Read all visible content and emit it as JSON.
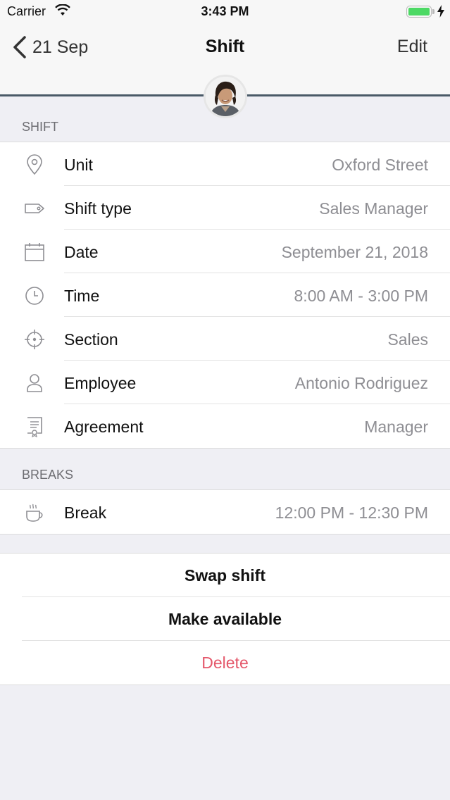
{
  "status_bar": {
    "carrier": "Carrier",
    "time": "3:43 PM",
    "battery_color": "#4cd964"
  },
  "nav": {
    "back_label": "21 Sep",
    "title": "Shift",
    "edit_label": "Edit",
    "accent_line_color": "#4a5a67"
  },
  "shift_section": {
    "header": "SHIFT",
    "rows": [
      {
        "icon": "location-pin-icon",
        "label": "Unit",
        "value": "Oxford Street"
      },
      {
        "icon": "tag-icon",
        "label": "Shift type",
        "value": "Sales Manager"
      },
      {
        "icon": "calendar-icon",
        "label": "Date",
        "value": "September 21, 2018"
      },
      {
        "icon": "clock-icon",
        "label": "Time",
        "value": "8:00 AM - 3:00 PM"
      },
      {
        "icon": "crosshair-icon",
        "label": "Section",
        "value": "Sales"
      },
      {
        "icon": "person-icon",
        "label": "Employee",
        "value": "Antonio Rodriguez"
      },
      {
        "icon": "certificate-icon",
        "label": "Agreement",
        "value": "Manager"
      }
    ]
  },
  "breaks_section": {
    "header": "BREAKS",
    "rows": [
      {
        "icon": "coffee-cup-icon",
        "label": "Break",
        "value": "12:00 PM - 12:30 PM"
      }
    ]
  },
  "actions": {
    "swap": "Swap shift",
    "make_available": "Make available",
    "delete": "Delete",
    "delete_color": "#e4576a"
  }
}
